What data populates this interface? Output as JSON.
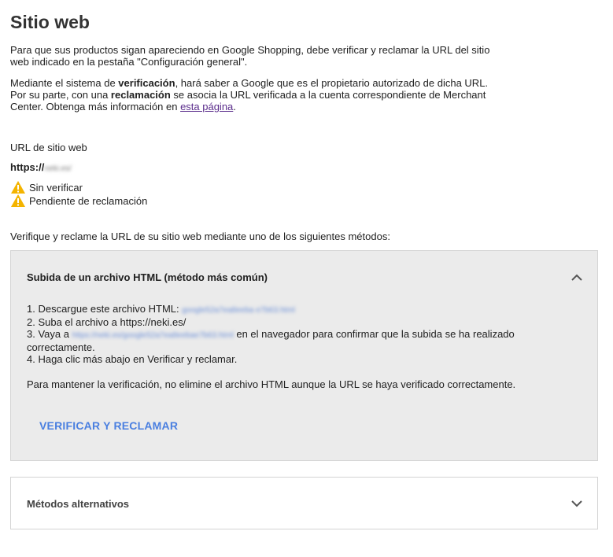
{
  "page": {
    "title": "Sitio web",
    "intro_1": "Para que sus productos sigan apareciendo en Google Shopping, debe verificar y reclamar la URL del sitio web indicado en la pestaña \"Configuración general\".",
    "intro_2_a": "Mediante el sistema de ",
    "intro_2_b": "verificación",
    "intro_2_c": ", hará saber a Google que es el propietario autorizado de dicha URL. Por su parte, con una ",
    "intro_2_d": "reclamación",
    "intro_2_e": " se asocia la URL verificada a la cuenta correspondiente de Merchant Center. Obtenga más información en ",
    "intro_2_link": "esta página",
    "intro_2_f": "."
  },
  "site": {
    "url_label": "URL de sitio web",
    "url_prefix": "https://",
    "url_blurred": "neki.es/",
    "status": [
      {
        "icon": "warning-icon",
        "label": "Sin verificar"
      },
      {
        "icon": "warning-icon",
        "label": "Pendiente de reclamación"
      }
    ],
    "methods_intro": "Verifique y reclame la URL de su sitio web mediante uno de los siguientes métodos:"
  },
  "html_method": {
    "header": "Subida de un archivo HTML (método más común)",
    "step1_prefix": "1. Descargue este archivo HTML: ",
    "step1_file": "google52a7ea8eeba e7b63.html",
    "step2": "2. Suba el archivo a https://neki.es/",
    "step3_prefix": "3. Vaya a ",
    "step3_link": "https://neki.es/google52a7ea8eebae7b63.html",
    "step3_suffix": " en el navegador para confirmar que la subida se ha realizado correctamente.",
    "step4": "4. Haga clic más abajo en Verificar y reclamar.",
    "keep_note": "Para mantener la verificación, no elimine el archivo HTML aunque la URL se haya verificado correctamente.",
    "verify_button": "VERIFICAR Y RECLAMAR"
  },
  "alt_methods": {
    "header": "Métodos alternativos"
  },
  "colors": {
    "warning": "#f4b400",
    "link": "#5b2d8c",
    "button": "#4a7fe0",
    "panel_bg": "#ebebeb"
  }
}
